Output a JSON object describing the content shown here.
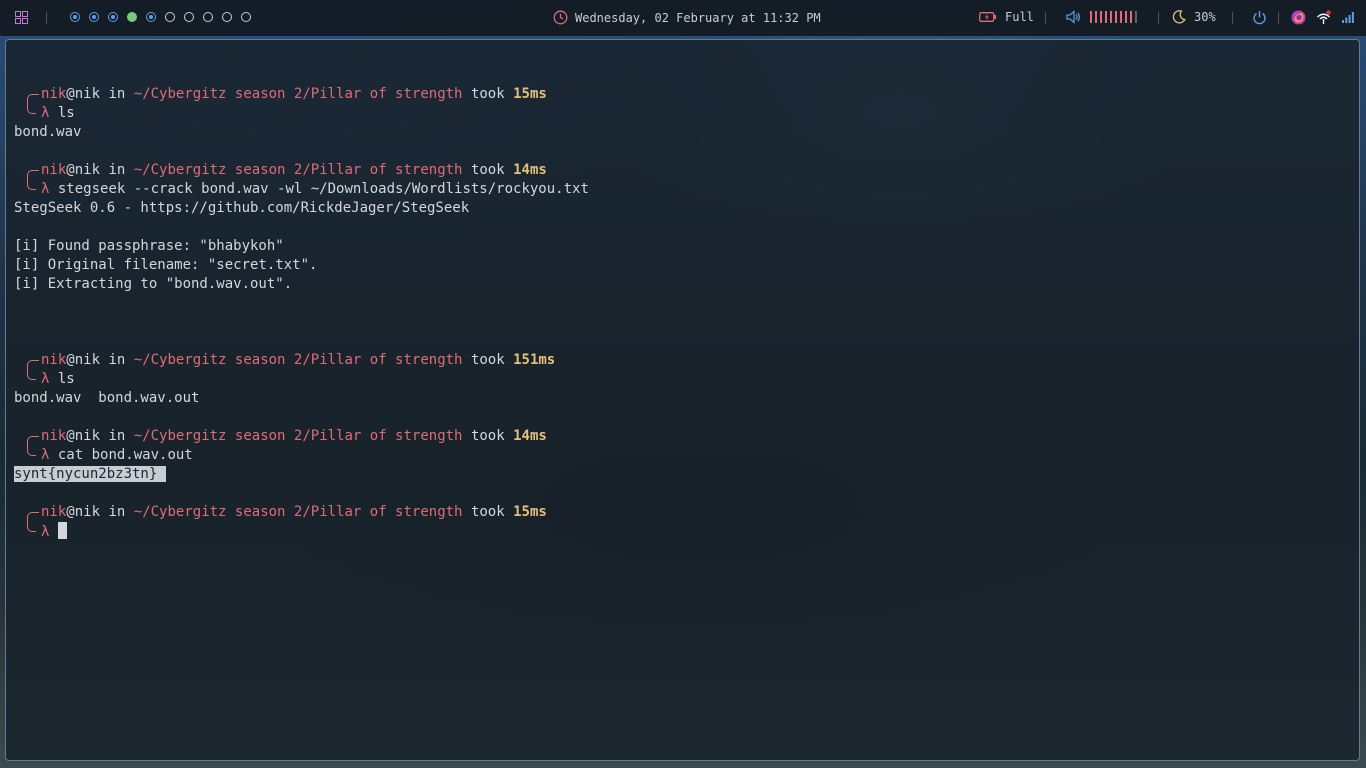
{
  "topbar": {
    "apps_icon": "grid-icon",
    "workspaces": [
      {
        "state": "active"
      },
      {
        "state": "active"
      },
      {
        "state": "active"
      },
      {
        "state": "current"
      },
      {
        "state": "active"
      },
      {
        "state": "empty"
      },
      {
        "state": "empty"
      },
      {
        "state": "empty"
      },
      {
        "state": "empty"
      },
      {
        "state": "empty"
      }
    ],
    "clock_icon": "clock-icon",
    "datetime": "Wednesday, 02 February at 11:32 PM",
    "battery_icon": "battery-charging-icon",
    "battery_label": "Full",
    "volume_icon": "speaker-icon",
    "volume_level": 0.9,
    "brightness_icon": "moon-icon",
    "brightness_label": "30%",
    "power_icon": "power-icon",
    "tray_icons": [
      "firefox-icon",
      "network-icon",
      "signal-icon"
    ]
  },
  "colors": {
    "prompt_user": "#e06c75",
    "prompt_path": "#e06c75",
    "prompt_time": "#e5c07b",
    "terminal_text": "#d4d7dd",
    "accent_blue": "#5aa0e6",
    "accent_green": "#7fc87a"
  },
  "terminal": {
    "prompt": {
      "user": "nik",
      "at": "@",
      "host": "nik",
      "in": "in",
      "path": "~/Cybergitz season 2/Pillar of strength",
      "took": "took",
      "lambda": "λ"
    },
    "blocks": [
      {
        "time": "15ms",
        "command": "ls",
        "output": [
          "bond.wav"
        ]
      },
      {
        "time": "14ms",
        "command": "stegseek --crack bond.wav -wl ~/Downloads/Wordlists/rockyou.txt",
        "output": [
          "StegSeek 0.6 - https://github.com/RickdeJager/StegSeek",
          "",
          "[i] Found passphrase: \"bhabykoh\"",
          "[i] Original filename: \"secret.txt\".",
          "[i] Extracting to \"bond.wav.out\".",
          "",
          ""
        ]
      },
      {
        "time": "151ms",
        "command": "ls",
        "output": [
          "bond.wav  bond.wav.out"
        ]
      },
      {
        "time": "14ms",
        "command": "cat bond.wav.out",
        "output_selected": "synt{nycun2bz3tn} "
      },
      {
        "time": "15ms",
        "command": ""
      }
    ]
  }
}
